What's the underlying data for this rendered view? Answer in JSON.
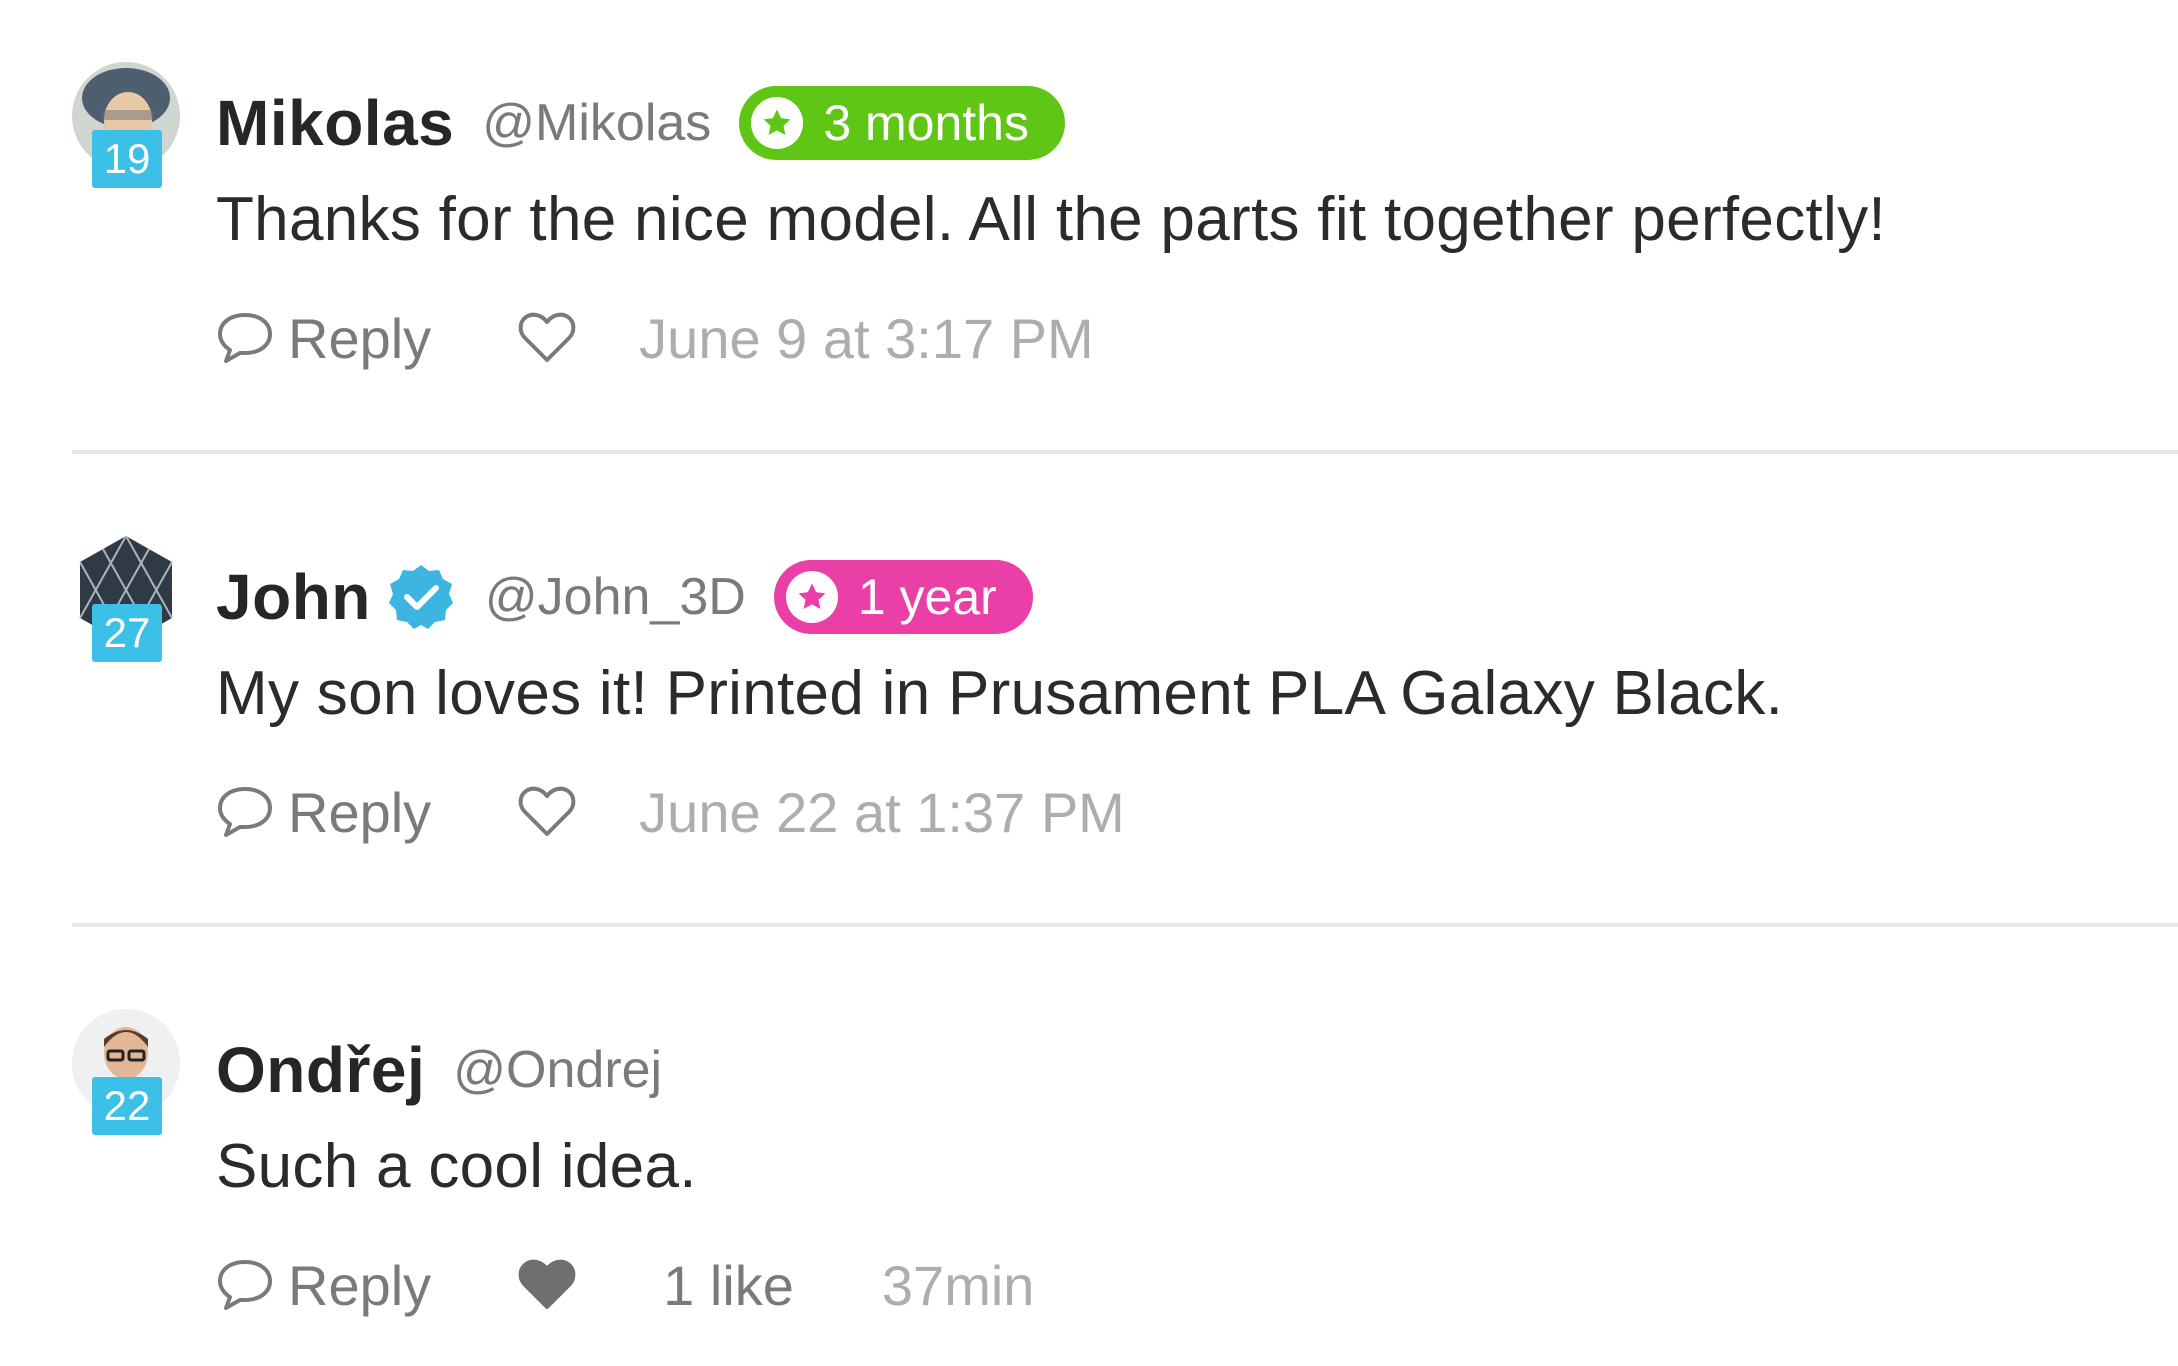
{
  "comments": [
    {
      "user_name": "Mikolas",
      "handle": "@Mikolas",
      "level": "19",
      "verified": false,
      "tenure": "3 months",
      "tenure_color": "#5fc615",
      "text": "Thanks for the nice model. All the parts fit together perfectly!",
      "reply_label": "Reply",
      "liked": false,
      "likes": "",
      "timestamp": "June 9 at 3:17 PM",
      "avatar_icon": "user-photo-avatar"
    },
    {
      "user_name": "John",
      "handle": "@John_3D",
      "level": "27",
      "verified": true,
      "tenure": "1 year",
      "tenure_color": "#ea3fa6",
      "text": "My son loves it! Printed in Prusament PLA Galaxy Black.",
      "reply_label": "Reply",
      "liked": false,
      "likes": "",
      "timestamp": "June 22 at 1:37 PM",
      "avatar_icon": "geometric-pattern-avatar"
    },
    {
      "user_name": "Ondřej",
      "handle": "@Ondrej",
      "level": "22",
      "verified": false,
      "tenure": "",
      "text": "Such a cool idea.",
      "reply_label": "Reply",
      "liked": true,
      "likes": "1 like",
      "timestamp": "37min",
      "avatar_icon": "user-photo-avatar"
    }
  ],
  "colors": {
    "level_badge": "#3cc0e8",
    "verified_badge": "#3cb6e0",
    "timestamp": "#adadad",
    "meta_text": "#7a7a7a"
  }
}
